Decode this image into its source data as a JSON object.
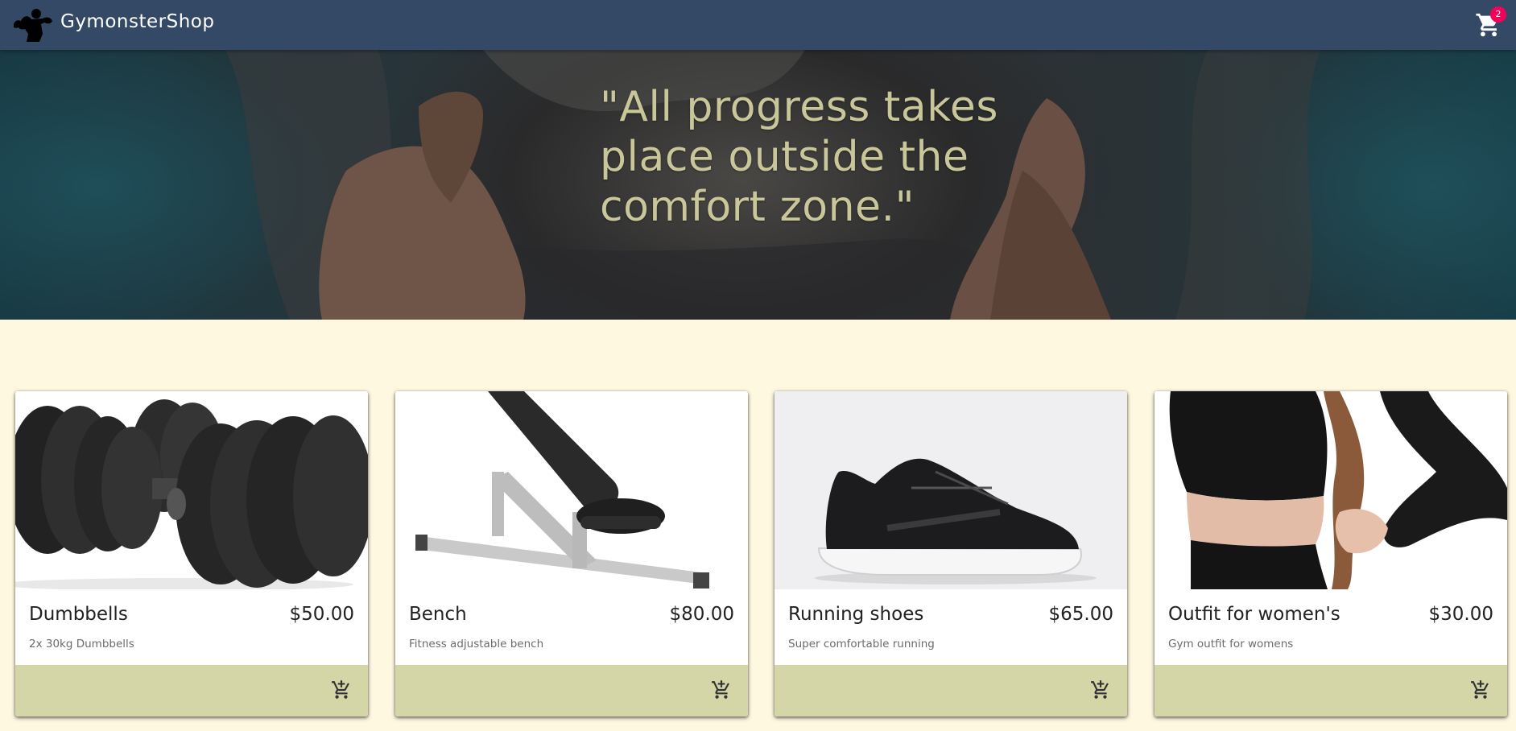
{
  "app": {
    "brand": "GymonsterShop",
    "cart_count": "2",
    "colors": {
      "appbar": "#344966",
      "badge": "#f50057",
      "page_bg": "#fff8e1",
      "card_actions": "#d4d6a7",
      "quote": "#c9c69a"
    }
  },
  "hero": {
    "quote": "\"All progress takes place outside the comfort zone.\""
  },
  "products": [
    {
      "name": "Dumbbells",
      "price": "$50.00",
      "description": "2x 30kg Dumbbells",
      "image": "dumbbells-image"
    },
    {
      "name": "Bench",
      "price": "$80.00",
      "description": "Fitness adjustable bench",
      "image": "bench-image"
    },
    {
      "name": "Running shoes",
      "price": "$65.00",
      "description": "Super comfortable running",
      "image": "running-shoes-image"
    },
    {
      "name": "Outfit for women's",
      "price": "$30.00",
      "description": "Gym outfit for womens",
      "image": "outfit-image"
    }
  ],
  "icons": {
    "logo": "bodybuilder-logo-icon",
    "cart": "shopping-cart-icon",
    "add_to_cart": "add-shopping-cart-icon"
  }
}
